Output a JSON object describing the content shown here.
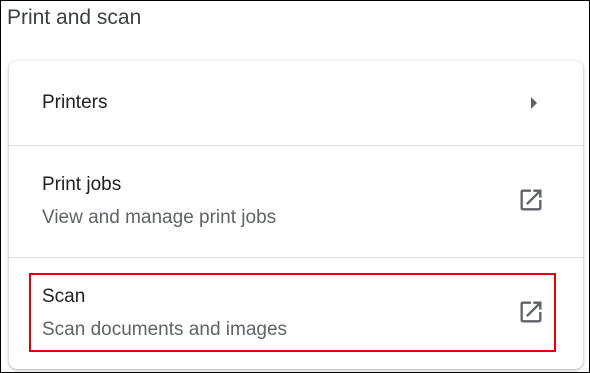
{
  "section": {
    "title": "Print and scan"
  },
  "rows": {
    "printers": {
      "label": "Printers",
      "icon": "arrow-right-icon"
    },
    "print_jobs": {
      "label": "Print jobs",
      "sublabel": "View and manage print jobs",
      "icon": "open-in-new-icon"
    },
    "scan": {
      "label": "Scan",
      "sublabel": "Scan documents and images",
      "icon": "open-in-new-icon"
    }
  },
  "colors": {
    "highlight": "#e3000b",
    "primary_text": "#202124",
    "secondary_text": "#5f6368",
    "icon": "#5f6368"
  }
}
